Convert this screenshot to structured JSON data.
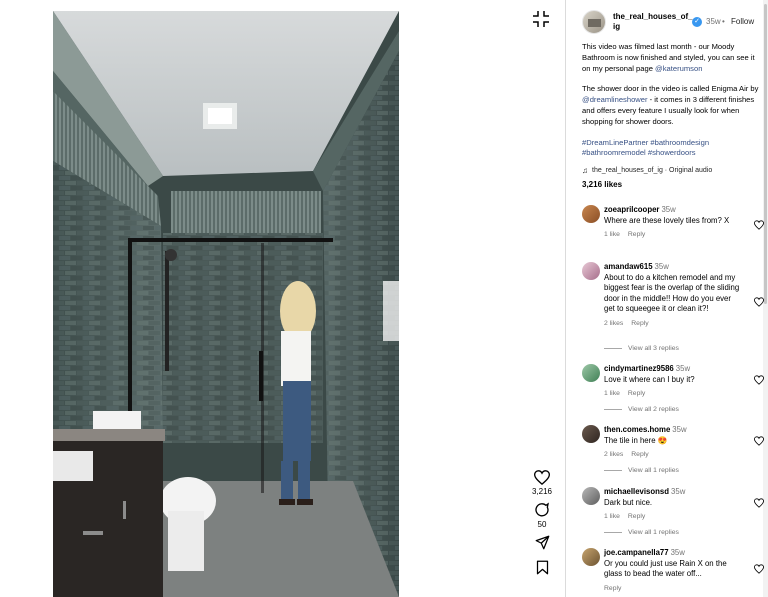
{
  "post": {
    "username": "the_real_houses_of_ig",
    "time": "35w",
    "dot": "•",
    "follow_label": "Follow",
    "caption_p1": "This video was filmed last month - our Moody Bathroom is now finished and styled, you can see it on my personal page",
    "caption_p1_mention": "@katerumson",
    "caption_p2_a": "The shower door in the video is called Enigma Air by",
    "caption_p2_mention": "@dreamlineshower",
    "caption_p2_b": "- it comes in 3 different finishes and offers every feature I usually look for when shopping for shower doors.",
    "hashtags": "#DreamLinePartner #bathroomdesign #bathroomremodel #showerdoors",
    "audio": "the_real_houses_of_ig · Original audio",
    "likes": "3,216 likes"
  },
  "rail": {
    "like_count": "3,216",
    "comment_count": "50"
  },
  "comments": [
    {
      "user": "zoeaprilcooper",
      "time": "35w",
      "text": "Where are these lovely tiles from? X",
      "likes": "1 like",
      "reply": "Reply",
      "view": ""
    },
    {
      "user": "amandaw615",
      "time": "35w",
      "text": "About to do a kitchen remodel and my biggest fear is the overlap of the sliding door in the middle!! How do you ever get to squeegee it or clean it?!",
      "likes": "2 likes",
      "reply": "Reply",
      "view": "View all 3 replies"
    },
    {
      "user": "cindymartinez9586",
      "time": "35w",
      "text": "Love it where can I buy it?",
      "likes": "1 like",
      "reply": "Reply",
      "view": "View all 2 replies"
    },
    {
      "user": "then.comes.home",
      "time": "35w",
      "text": "The tile in here 😍",
      "likes": "2 likes",
      "reply": "Reply",
      "view": "View all 1 replies"
    },
    {
      "user": "michaellevisonsd",
      "time": "35w",
      "text": "Dark but nice.",
      "likes": "1 like",
      "reply": "Reply",
      "view": "View all 1 replies"
    },
    {
      "user": "joe.campanella77",
      "time": "35w",
      "text": "Or you could just use Rain X on the glass to bead the water off...",
      "likes": "",
      "reply": "Reply",
      "view": ""
    }
  ],
  "colors": {
    "link": "#385185",
    "verified": "#3897f0",
    "muted": "#737373"
  },
  "icons": [
    "collapse-icon",
    "heart-icon",
    "comment-icon",
    "share-icon",
    "bookmark-icon",
    "verified-icon",
    "music-note-icon"
  ]
}
